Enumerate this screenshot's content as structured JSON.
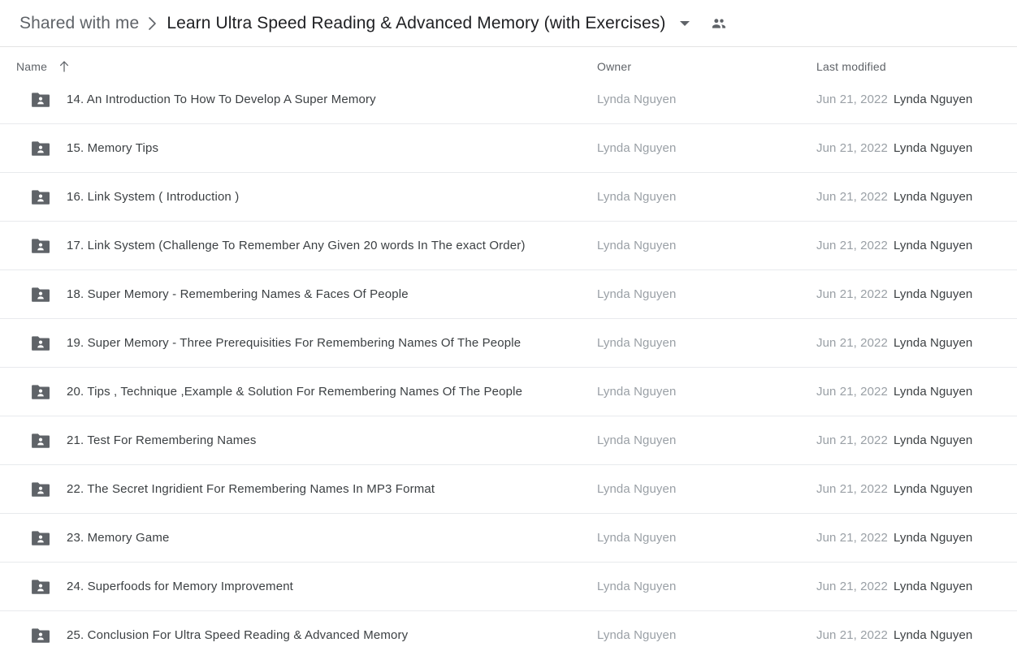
{
  "header": {
    "breadcrumb_root": "Shared with me",
    "breadcrumb_separator_icon": "chevron-right-icon",
    "breadcrumb_current": "Learn Ultra Speed Reading & Advanced Memory (with Exercises)",
    "caret_icon": "caret-down-icon",
    "people_icon": "people-icon",
    "border_color": "#e3e3e3"
  },
  "columns": {
    "name": "Name",
    "sort_icon": "arrow-up-icon",
    "owner": "Owner",
    "last_modified": "Last modified"
  },
  "colors": {
    "text_primary": "#3c4043",
    "text_secondary": "#5f6368",
    "text_muted": "#9aa0a6",
    "divider": "#e8eaed",
    "folder_icon": "#5f6368",
    "background": "#ffffff"
  },
  "rows": [
    {
      "icon": "shared-folder-icon",
      "name": "14. An Introduction To How To Develop A Super Memory",
      "owner": "Lynda Nguyen",
      "modified_date": "Jun 21, 2022",
      "modified_by": "Lynda Nguyen"
    },
    {
      "icon": "shared-folder-icon",
      "name": "15. Memory Tips",
      "owner": "Lynda Nguyen",
      "modified_date": "Jun 21, 2022",
      "modified_by": "Lynda Nguyen"
    },
    {
      "icon": "shared-folder-icon",
      "name": "16. Link System ( Introduction )",
      "owner": "Lynda Nguyen",
      "modified_date": "Jun 21, 2022",
      "modified_by": "Lynda Nguyen"
    },
    {
      "icon": "shared-folder-icon",
      "name": "17. Link System (Challenge To Remember Any Given 20 words In The exact Order)",
      "owner": "Lynda Nguyen",
      "modified_date": "Jun 21, 2022",
      "modified_by": "Lynda Nguyen"
    },
    {
      "icon": "shared-folder-icon",
      "name": "18. Super Memory - Remembering Names & Faces Of People",
      "owner": "Lynda Nguyen",
      "modified_date": "Jun 21, 2022",
      "modified_by": "Lynda Nguyen"
    },
    {
      "icon": "shared-folder-icon",
      "name": "19. Super Memory - Three Prerequisities For Remembering Names Of The People",
      "owner": "Lynda Nguyen",
      "modified_date": "Jun 21, 2022",
      "modified_by": "Lynda Nguyen"
    },
    {
      "icon": "shared-folder-icon",
      "name": "20. Tips , Technique ,Example & Solution For Remembering Names Of The People",
      "owner": "Lynda Nguyen",
      "modified_date": "Jun 21, 2022",
      "modified_by": "Lynda Nguyen"
    },
    {
      "icon": "shared-folder-icon",
      "name": "21. Test For Remembering Names",
      "owner": "Lynda Nguyen",
      "modified_date": "Jun 21, 2022",
      "modified_by": "Lynda Nguyen"
    },
    {
      "icon": "shared-folder-icon",
      "name": "22. The Secret Ingridient For Remembering Names In MP3 Format",
      "owner": "Lynda Nguyen",
      "modified_date": "Jun 21, 2022",
      "modified_by": "Lynda Nguyen"
    },
    {
      "icon": "shared-folder-icon",
      "name": "23. Memory Game",
      "owner": "Lynda Nguyen",
      "modified_date": "Jun 21, 2022",
      "modified_by": "Lynda Nguyen"
    },
    {
      "icon": "shared-folder-icon",
      "name": "24. Superfoods for Memory Improvement",
      "owner": "Lynda Nguyen",
      "modified_date": "Jun 21, 2022",
      "modified_by": "Lynda Nguyen"
    },
    {
      "icon": "shared-folder-icon",
      "name": "25. Conclusion For Ultra Speed Reading & Advanced Memory",
      "owner": "Lynda Nguyen",
      "modified_date": "Jun 21, 2022",
      "modified_by": "Lynda Nguyen"
    }
  ]
}
